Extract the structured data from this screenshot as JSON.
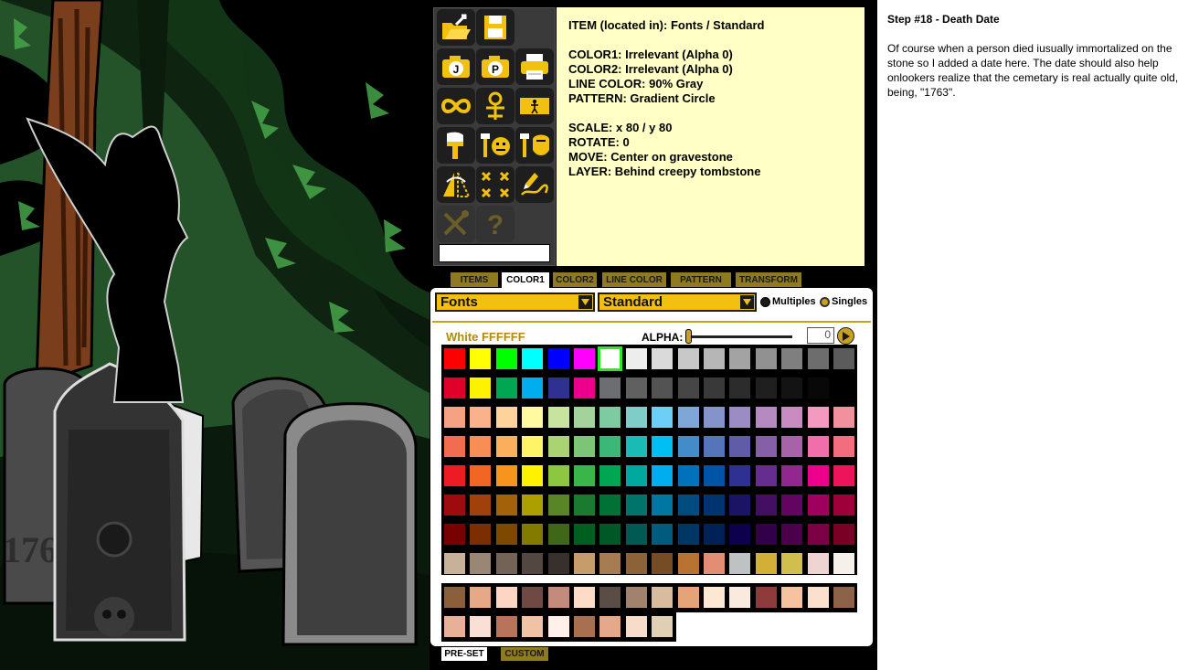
{
  "toolbar": {
    "tools": [
      {
        "name": "open-folder-icon"
      },
      {
        "name": "save-disk-icon"
      },
      {
        "name": "camera-j-icon"
      },
      {
        "name": "camera-p-icon"
      },
      {
        "name": "printer-icon"
      },
      {
        "name": "infinity-icon"
      },
      {
        "name": "ankh-icon"
      },
      {
        "name": "figure-card-icon"
      },
      {
        "name": "paint-brush-icon"
      },
      {
        "name": "face-brush-icon"
      },
      {
        "name": "hair-brush-icon"
      },
      {
        "name": "mirror-flip-icon"
      },
      {
        "name": "cross-out-icon"
      },
      {
        "name": "pencil-path-icon"
      },
      {
        "name": "tools-disabled-icon"
      },
      {
        "name": "help-question-icon"
      }
    ],
    "text_value": ""
  },
  "info": {
    "lines_a": [
      "ITEM (located in): Fonts / Standard"
    ],
    "lines_b": [
      "COLOR1: Irrelevant (Alpha 0)",
      "COLOR2: Irrelevant (Alpha 0)",
      "LINE COLOR: 90% Gray",
      "PATTERN: Gradient Circle"
    ],
    "lines_c": [
      "SCALE: x 80 / y 80",
      "ROTATE: 0",
      "MOVE: Center on gravestone",
      "LAYER: Behind creepy tombstone"
    ]
  },
  "tabs": [
    "ITEMS",
    "COLOR1",
    "COLOR2",
    "LINE COLOR",
    "PATTERN",
    "TRANSFORM"
  ],
  "active_tab": "COLOR1",
  "panel": {
    "category_select": "Fonts",
    "subcategory_select": "Standard",
    "multiples_label": "Multiples",
    "singles_label": "Singles",
    "selected_mode": "Singles",
    "color_name": "White FFFFFF",
    "alpha_label": "ALPHA:",
    "alpha_value": "0"
  },
  "palette": {
    "selected": "#FFFFFF",
    "rows": [
      [
        "#FF0000",
        "#FFFF00",
        "#00FF00",
        "#00FFFF",
        "#0000FF",
        "#FF00FF",
        "#FFFFFF",
        "#EDEDED",
        "#DADADA",
        "#C8C8C8",
        "#B6B6B6",
        "#A3A3A3",
        "#919191",
        "#7F7F7F",
        "#6D6D6D",
        "#5B5B5B"
      ],
      [
        "#E0002A",
        "#FFF200",
        "#00A651",
        "#00AEEF",
        "#2E3192",
        "#EC008C",
        "#6D6E71",
        "#606060",
        "#535353",
        "#464646",
        "#393939",
        "#2C2C2C",
        "#1F1F1F",
        "#131313",
        "#080808",
        "#000000"
      ],
      [
        "#F7A184",
        "#F9B28A",
        "#FDD39B",
        "#FFF9A0",
        "#C8E3A0",
        "#A2D39C",
        "#7DCBA0",
        "#7ECDC9",
        "#6DCFF6",
        "#7EA7D8",
        "#8493CA",
        "#9B8DC3",
        "#B48AC0",
        "#C98CC0",
        "#F49AC1",
        "#F3909D"
      ],
      [
        "#F26C4F",
        "#F68E55",
        "#FBAF5C",
        "#FFF467",
        "#ACD372",
        "#7CC576",
        "#3BB878",
        "#1ABBB4",
        "#00BFF3",
        "#438CCA",
        "#5574B9",
        "#605CA8",
        "#855FA8",
        "#A763A8",
        "#F06EA9",
        "#F26D7D"
      ],
      [
        "#ED1C24",
        "#F26522",
        "#F7941D",
        "#FFF200",
        "#8DC63F",
        "#39B54A",
        "#00A651",
        "#00A99D",
        "#00AEEF",
        "#0072BC",
        "#0054A6",
        "#2E3192",
        "#662D91",
        "#92278F",
        "#EC008C",
        "#ED145B"
      ],
      [
        "#9E0B0F",
        "#A0410D",
        "#A36209",
        "#ABA000",
        "#598527",
        "#1A7B30",
        "#007236",
        "#00746B",
        "#0076A3",
        "#004B80",
        "#003471",
        "#1B1464",
        "#440E62",
        "#630460",
        "#9E005D",
        "#9E0039"
      ],
      [
        "#790000",
        "#7B2E00",
        "#7D4900",
        "#827B00",
        "#406618",
        "#005E20",
        "#005826",
        "#005952",
        "#005B7F",
        "#003663",
        "#002157",
        "#0D004C",
        "#32004B",
        "#4B0049",
        "#7B0046",
        "#7A0026"
      ],
      [
        "#C7B299",
        "#998675",
        "#736357",
        "#534741",
        "#37302D",
        "#C69C6D",
        "#A67C52",
        "#8C6239",
        "#754C24",
        "#B87333",
        "#E38E74",
        "#BEC2C3",
        "#D4AF37",
        "#D1BF4D",
        "#EED5D2",
        "#F5F0EA"
      ]
    ],
    "preset_row1": [
      "#8B5E3C",
      "#E5A985",
      "#FCD6C2",
      "#6E4A42",
      "#C48B7C",
      "#FDDBC7",
      "#5A4D45",
      "#A0826D",
      "#D9BBA0",
      "#E3A478",
      "#FDE6D2",
      "#F9EAE0",
      "#8E3B3B",
      "#F7C2A0",
      "#FCE0CE",
      "#8C6248"
    ],
    "preset_row2": [
      "#E8B096",
      "#FAE0D4",
      "#B9735A",
      "#F2C2A4",
      "#FFF1EA",
      "#A9704F",
      "#E6A88A",
      "#F8DCCA",
      "#E0CFB3"
    ]
  },
  "bottom_tabs": [
    "PRE-SET",
    "CUSTOM"
  ],
  "description": {
    "title": "Step #18 - Death Date",
    "body": "Of course when a person died iusually immortalized on the stone so I added a date here. The date should also help onlookers realize that the cemetary is real actually quite old, being, \"1763\"."
  },
  "scene": {
    "engraving": "1763"
  }
}
